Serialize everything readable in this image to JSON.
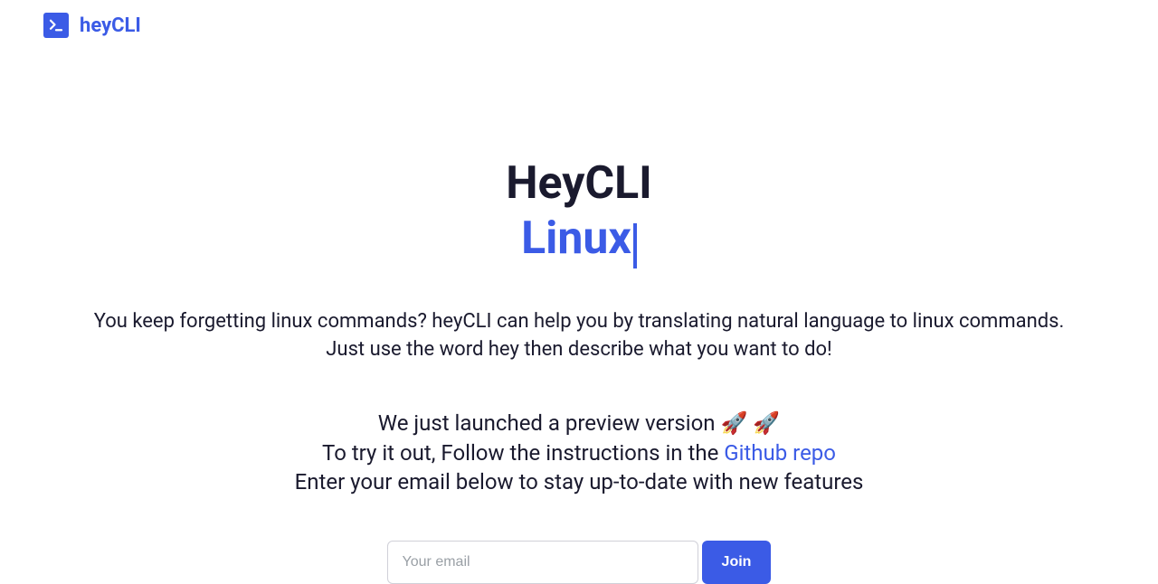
{
  "header": {
    "logo_text": "heyCLI"
  },
  "hero": {
    "title": "HeyCLI",
    "subtitle": "Linux",
    "description_line1": "You keep forgetting linux commands? heyCLI can help you by translating natural language to linux commands.",
    "description_line2": "Just use the word hey then describe what you want to do!"
  },
  "launch": {
    "line1": "We just launched a preview version 🚀 🚀",
    "line2_prefix": "To try it out, Follow the instructions in the ",
    "line2_link": "Github repo",
    "line3": "Enter your email below to stay up-to-date with new features"
  },
  "form": {
    "email_placeholder": "Your email",
    "join_label": "Join"
  }
}
